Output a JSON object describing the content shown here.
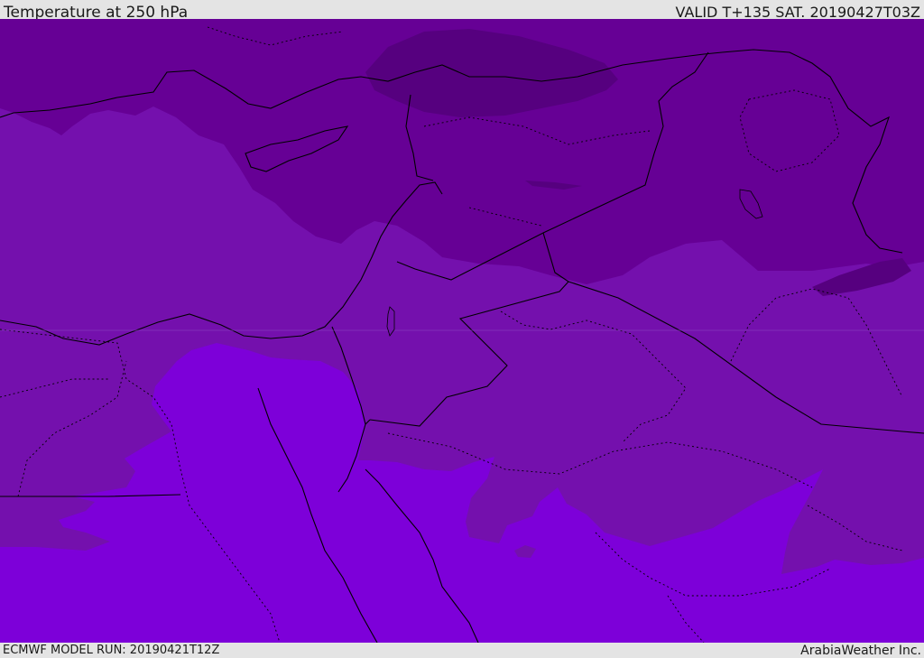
{
  "header": {
    "title": "Temperature at 250 hPa",
    "valid": "VALID T+135 SAT. 20190427T03Z"
  },
  "footer": {
    "model_run": "ECMWF MODEL RUN: 20190421T12Z",
    "brand": "ArabiaWeather Inc."
  },
  "map": {
    "variable": "Temperature",
    "level": "250 hPa",
    "colors": {
      "coldest": "#56007f",
      "cold": "#660095",
      "mid": "#7410ad",
      "warm": "#7d00d9",
      "boundary": "#000000"
    }
  }
}
